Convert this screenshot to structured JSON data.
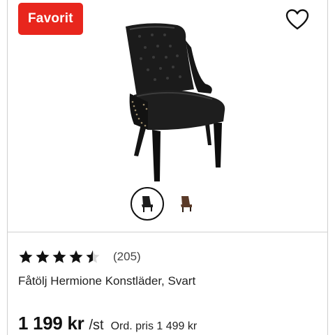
{
  "product": {
    "badge": "Favorit",
    "favorite_icon": "heart-outline-icon",
    "image_alt": "chair-icon",
    "thumbnails": [
      {
        "name": "black-variant",
        "color": "#1c1c1c",
        "selected": true
      },
      {
        "name": "brown-variant",
        "color": "#5a3a28",
        "selected": false
      }
    ],
    "rating": {
      "value": 4.5,
      "max": 5,
      "count_label": "(205)"
    },
    "title": "Fåtölj Hermione Konstläder, Svart",
    "price": "1 199 kr",
    "unit": "/st",
    "ordinary_price": "Ord. pris 1 499 kr"
  },
  "colors": {
    "badge_bg": "#e8261d",
    "text": "#111111",
    "border": "#d0d0d0"
  }
}
